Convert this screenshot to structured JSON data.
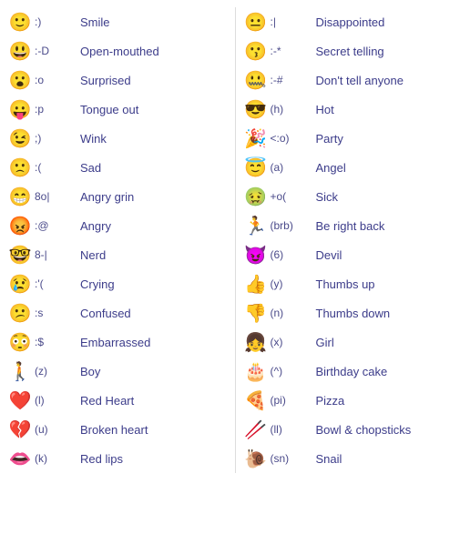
{
  "left_column": [
    {
      "emoji": "🙂",
      "code": ":)",
      "name": "Smile"
    },
    {
      "emoji": "😃",
      "code": ":-D",
      "name": "Open-mouthed"
    },
    {
      "emoji": "😮",
      "code": ":o",
      "name": "Surprised"
    },
    {
      "emoji": "😛",
      "code": ":p",
      "name": "Tongue out"
    },
    {
      "emoji": "😉",
      "code": ";)",
      "name": "Wink"
    },
    {
      "emoji": "🙁",
      "code": ":(",
      "name": "Sad"
    },
    {
      "emoji": "😁",
      "code": "8o|",
      "name": "Angry grin"
    },
    {
      "emoji": "😡",
      "code": ":@",
      "name": "Angry"
    },
    {
      "emoji": "🤓",
      "code": "8-|",
      "name": "Nerd"
    },
    {
      "emoji": "😢",
      "code": ":'(",
      "name": "Crying"
    },
    {
      "emoji": "😕",
      "code": ":s",
      "name": "Confused"
    },
    {
      "emoji": "😳",
      "code": ":$",
      "name": "Embarrassed"
    },
    {
      "emoji": "🚶",
      "code": "(z)",
      "name": "Boy"
    },
    {
      "emoji": "❤️",
      "code": "(l)",
      "name": "Red Heart"
    },
    {
      "emoji": "💔",
      "code": "(u)",
      "name": "Broken heart"
    },
    {
      "emoji": "👄",
      "code": "(k)",
      "name": "Red lips"
    }
  ],
  "right_column": [
    {
      "emoji": "😐",
      "code": ":|",
      "name": "Disappointed"
    },
    {
      "emoji": "😗",
      "code": ":-*",
      "name": "Secret telling"
    },
    {
      "emoji": "🤐",
      "code": ":-#",
      "name": "Don't tell anyone"
    },
    {
      "emoji": "😎",
      "code": "(h)",
      "name": "Hot"
    },
    {
      "emoji": "🎉",
      "code": "<:o)",
      "name": "Party"
    },
    {
      "emoji": "😇",
      "code": "(a)",
      "name": "Angel"
    },
    {
      "emoji": "🤢",
      "code": "+o(",
      "name": "Sick"
    },
    {
      "emoji": "🏃",
      "code": "(brb)",
      "name": "Be right back"
    },
    {
      "emoji": "😈",
      "code": "(6)",
      "name": "Devil"
    },
    {
      "emoji": "👍",
      "code": "(y)",
      "name": "Thumbs up"
    },
    {
      "emoji": "👎",
      "code": "(n)",
      "name": "Thumbs down"
    },
    {
      "emoji": "👧",
      "code": "(x)",
      "name": "Girl"
    },
    {
      "emoji": "🎂",
      "code": "(^)",
      "name": "Birthday cake"
    },
    {
      "emoji": "🍕",
      "code": "(pi)",
      "name": "Pizza"
    },
    {
      "emoji": "🥢",
      "code": "(ll)",
      "name": "Bowl & chopsticks"
    },
    {
      "emoji": "🐌",
      "code": "(sn)",
      "name": "Snail"
    }
  ]
}
